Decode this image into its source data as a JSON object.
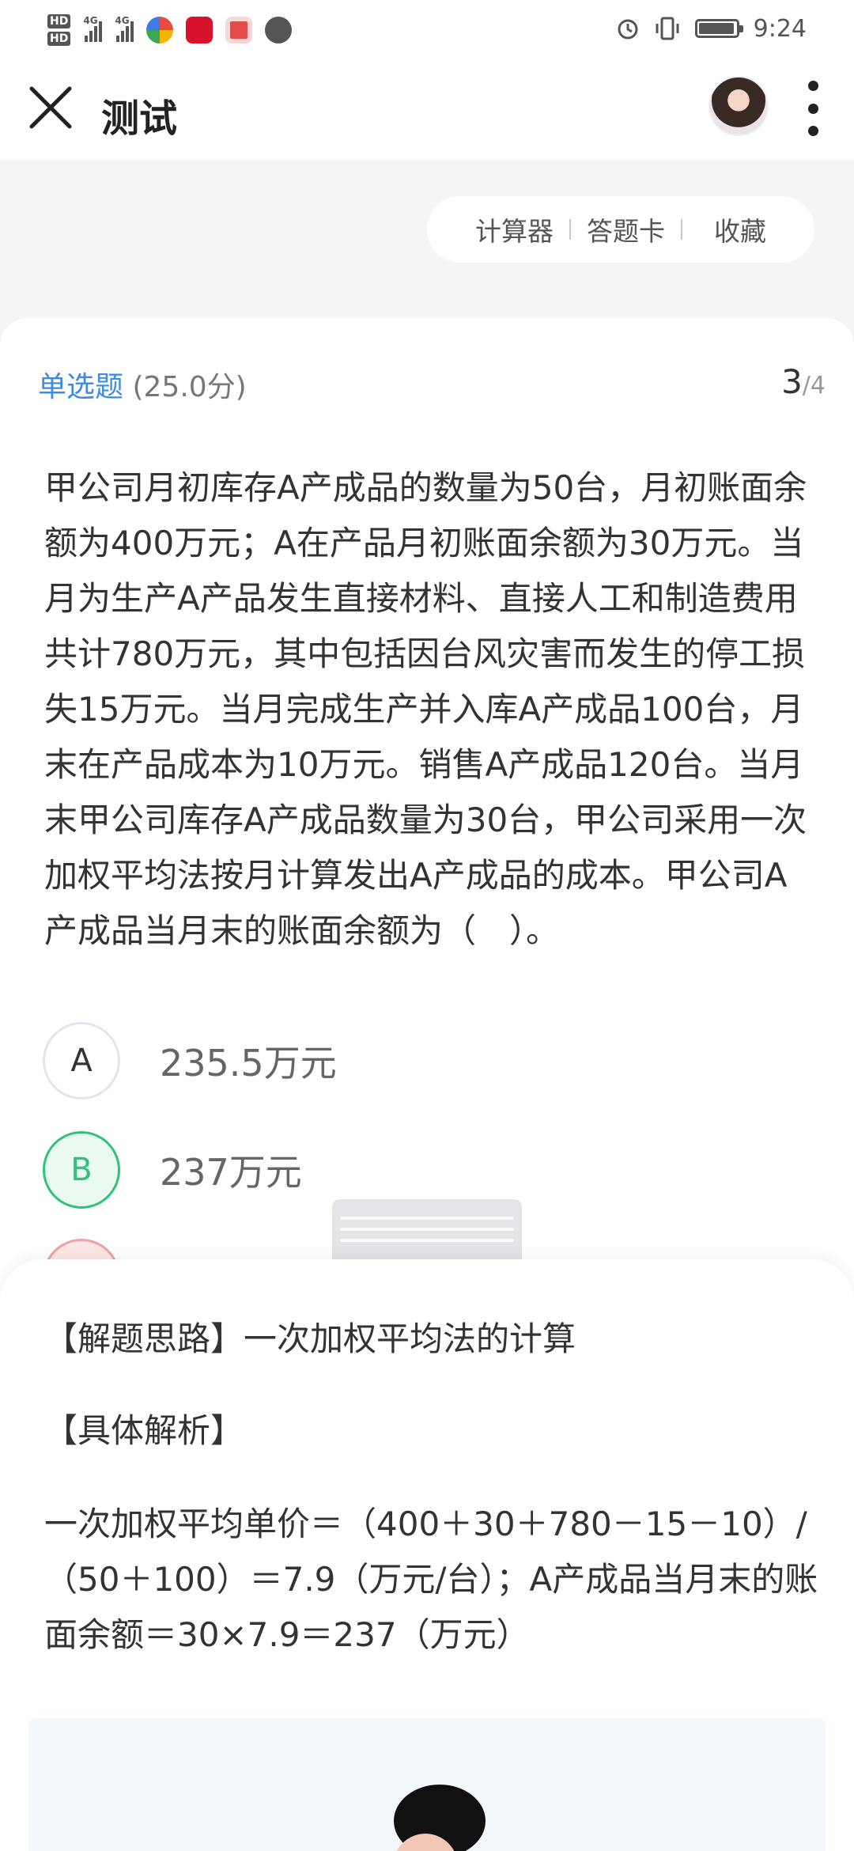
{
  "status_bar": {
    "hd1": "HD",
    "hd2": "HD",
    "network1": "4G",
    "network2": "4G",
    "time": "9:24"
  },
  "header": {
    "title": "测试",
    "icons": [
      "close-icon",
      "avatar",
      "more-icon"
    ]
  },
  "toolbar": {
    "calculator": "计算器",
    "answer_card": "答题卡",
    "favorite": "收藏"
  },
  "question": {
    "type": "单选题",
    "score": "(25.0分)",
    "current": "3",
    "total": "/4",
    "text": "甲公司月初库存A产成品的数量为50台，月初账面余额为400万元；A在产品月初账面余额为30万元。当月为生产A产品发生直接材料、直接人工和制造费用共计780万元，其中包括因台风灾害而发生的停工损失15万元。当月完成生产并入库A产成品100台，月末在产品成本为10万元。销售A产成品120台。当月末甲公司库存A产成品数量为30台，甲公司采用一次加权平均法按月计算发出A产成品的成本。甲公司A产成品当月末的账面余额为（　）。",
    "options": [
      {
        "letter": "A",
        "text": "235.5万元",
        "state": "normal"
      },
      {
        "letter": "B",
        "text": "237万元",
        "state": "correct"
      }
    ]
  },
  "analysis": {
    "approach": "【解题思路】一次加权平均法的计算",
    "detail_heading": "【具体解析】",
    "detail_text": "一次加权平均单价＝（400＋30＋780－15－10）/（50＋100）＝7.9（万元/台）；A产成品当月末的账面余额＝30×7.9＝237（万元）"
  },
  "colors": {
    "accent_blue": "#3c8be8",
    "correct_green": "#2fc37a",
    "wrong_red": "#f2a0a0"
  }
}
